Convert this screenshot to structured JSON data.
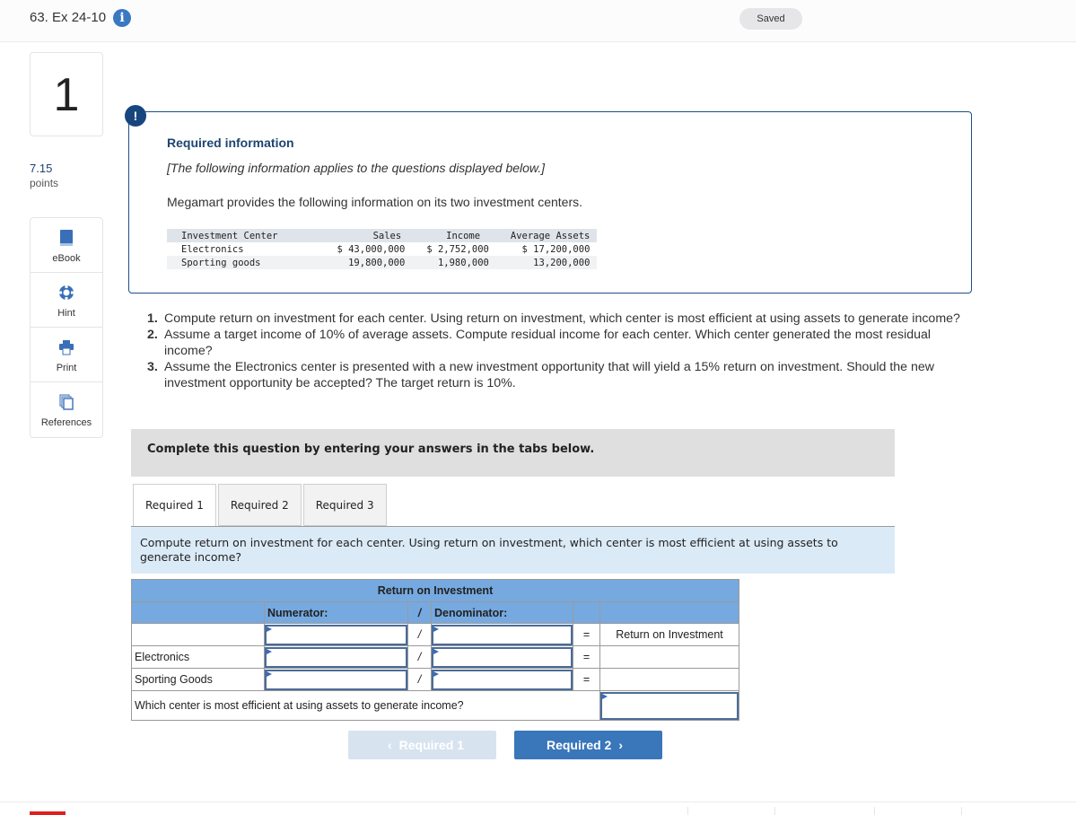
{
  "header": {
    "question_title": "63. Ex 24-10",
    "info_icon": "info-icon",
    "saved_label": "Saved"
  },
  "sidebar": {
    "question_number": "1",
    "points_value": "7.15",
    "points_label": "points",
    "tools": [
      {
        "label": "eBook",
        "icon": "book-icon"
      },
      {
        "label": "Hint",
        "icon": "lifebuoy-icon"
      },
      {
        "label": "Print",
        "icon": "printer-icon"
      },
      {
        "label": "References",
        "icon": "copies-icon"
      }
    ]
  },
  "info_box": {
    "alert_icon": "!",
    "title": "Required information",
    "subtitle": "[The following information applies to the questions displayed below.]",
    "description": "Megamart provides the following information on its two investment centers.",
    "table": {
      "headers": [
        "Investment Center",
        "Sales",
        "Income",
        "Average Assets"
      ],
      "rows": [
        [
          "Electronics",
          "$ 43,000,000",
          "$ 2,752,000",
          "$ 17,200,000"
        ],
        [
          "Sporting goods",
          "19,800,000",
          "1,980,000",
          "13,200,000"
        ]
      ]
    }
  },
  "questions": [
    {
      "num": "1.",
      "text": "Compute return on investment for each center. Using return on investment, which center is most efficient at using assets to generate income?"
    },
    {
      "num": "2.",
      "text": "Assume a target income of 10% of average assets. Compute residual income for each center. Which center generated the most residual income?"
    },
    {
      "num": "3.",
      "text": "Assume the Electronics center is presented with a new investment opportunity that will yield a 15% return on investment. Should the new investment opportunity be accepted? The target return is 10%."
    }
  ],
  "complete_banner": "Complete this question by entering your answers in the tabs below.",
  "tabs": [
    {
      "label": "Required 1",
      "active": true
    },
    {
      "label": "Required 2",
      "active": false
    },
    {
      "label": "Required 3",
      "active": false
    }
  ],
  "instruction": "Compute return on investment for each center. Using return on investment, which center is most efficient at using assets to generate income?",
  "roi_table": {
    "title": "Return on Investment",
    "numerator_label": "Numerator:",
    "divide_symbol": "/",
    "denominator_label": "Denominator:",
    "equals_symbol": "=",
    "result_label": "Return on Investment",
    "rows": [
      {
        "label": "",
        "numerator": "",
        "denominator": "",
        "result": "Return on Investment"
      },
      {
        "label": "Electronics",
        "numerator": "",
        "denominator": "",
        "result": ""
      },
      {
        "label": "Sporting Goods",
        "numerator": "",
        "denominator": "",
        "result": ""
      }
    ],
    "efficiency_question": "Which center is most efficient at using assets to generate income?",
    "efficiency_answer": ""
  },
  "navigation": {
    "prev_label": "Required 1",
    "prev_enabled": false,
    "next_label": "Required 2",
    "next_enabled": true
  }
}
